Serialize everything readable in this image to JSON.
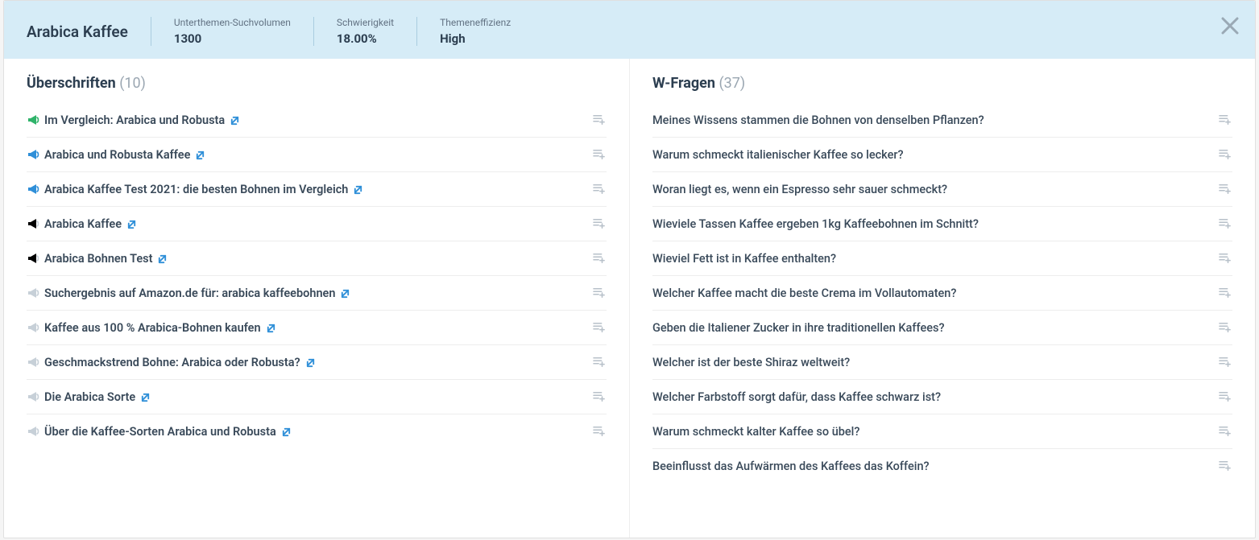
{
  "header": {
    "title": "Arabica Kaffee",
    "stats": [
      {
        "label": "Unterthemen-Suchvolumen",
        "value": "1300"
      },
      {
        "label": "Schwierigkeit",
        "value": "18.00%"
      },
      {
        "label": "Themeneffizienz",
        "value": "High"
      }
    ]
  },
  "left": {
    "title": "Überschriften",
    "count": "(10)",
    "items": [
      {
        "text": "Im Vergleich: Arabica und Robusta",
        "variant": "green"
      },
      {
        "text": "Arabica und Robusta Kaffee",
        "variant": "blue"
      },
      {
        "text": "Arabica Kaffee Test 2021: die besten Bohnen im Vergleich",
        "variant": "blue"
      },
      {
        "text": "Arabica Kaffee",
        "variant": "twotone"
      },
      {
        "text": "Arabica Bohnen Test",
        "variant": "twotone"
      },
      {
        "text": "Suchergebnis auf Amazon.de für: arabica kaffeebohnen",
        "variant": "light"
      },
      {
        "text": "Kaffee aus 100 % Arabica-Bohnen kaufen",
        "variant": "light"
      },
      {
        "text": "Geschmackstrend Bohne: Arabica oder Robusta?",
        "variant": "light"
      },
      {
        "text": "Die Arabica Sorte",
        "variant": "light"
      },
      {
        "text": "Über die Kaffee-Sorten Arabica und Robusta",
        "variant": "light"
      }
    ]
  },
  "right": {
    "title": "W-Fragen",
    "count": "(37)",
    "items": [
      {
        "text": "Meines Wissens stammen die Bohnen von denselben Pflanzen?"
      },
      {
        "text": "Warum schmeckt italienischer Kaffee so lecker?"
      },
      {
        "text": "Woran liegt es, wenn ein Espresso sehr sauer schmeckt?"
      },
      {
        "text": "Wieviele Tassen Kaffee ergeben 1kg Kaffeebohnen im Schnitt?"
      },
      {
        "text": "Wieviel Fett ist in Kaffee enthalten?"
      },
      {
        "text": "Welcher Kaffee macht die beste Crema im Vollautomaten?"
      },
      {
        "text": "Geben die Italiener Zucker in ihre traditionellen Kaffees?"
      },
      {
        "text": "Welcher ist der beste Shiraz weltweit?"
      },
      {
        "text": "Welcher Farbstoff sorgt dafür, dass Kaffee schwarz ist?"
      },
      {
        "text": "Warum schmeckt kalter Kaffee so übel?"
      },
      {
        "text": "Beeinflusst das Aufwärmen des Kaffees das Koffein?"
      }
    ]
  }
}
